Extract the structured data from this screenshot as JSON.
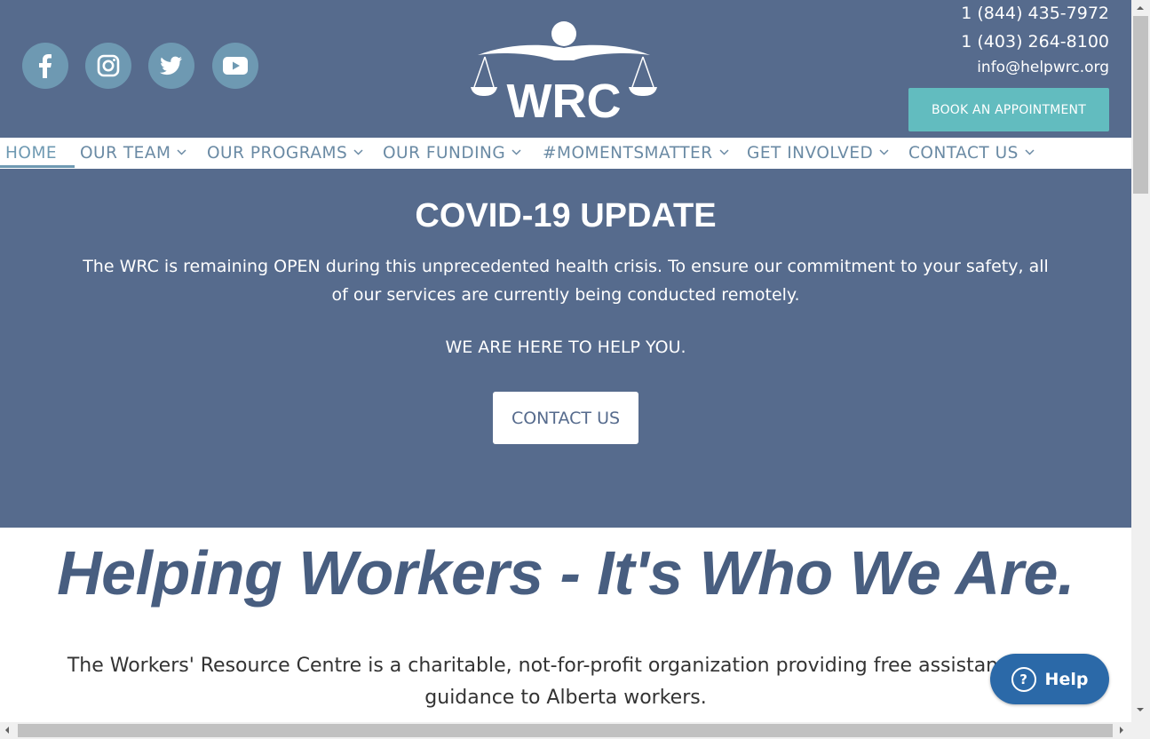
{
  "header": {
    "social": [
      {
        "name": "facebook-icon"
      },
      {
        "name": "instagram-icon"
      },
      {
        "name": "twitter-icon"
      },
      {
        "name": "youtube-icon"
      }
    ],
    "logo_text": "WRC",
    "phone1": "1 (844) 435-7972",
    "phone2": "1 (403) 264-8100",
    "email": "info@helpwrc.org",
    "book_label": "BOOK AN APPOINTMENT"
  },
  "nav": {
    "items": [
      {
        "label": "HOME",
        "active": true
      },
      {
        "label": "OUR TEAM"
      },
      {
        "label": "OUR PROGRAMS"
      },
      {
        "label": "OUR FUNDING"
      },
      {
        "label": "#MOMENTSMATTER"
      },
      {
        "label": "GET INVOLVED"
      },
      {
        "label": "CONTACT US"
      }
    ]
  },
  "hero": {
    "title": "COVID-19 UPDATE",
    "text": "The WRC is remaining OPEN during this unprecedented health crisis. To ensure our commitment to your safety, all of our services are currently being conducted remotely.",
    "sub": "WE ARE HERE TO HELP YOU.",
    "button": "CONTACT US"
  },
  "main": {
    "tagline": "Helping Workers - It's Who We Are.",
    "intro": "The Workers' Resource Centre is a charitable, not-for-profit organization providing free assistance and guidance to Alberta workers."
  },
  "help": {
    "label": "Help"
  },
  "colors": {
    "header_bg": "#566b8d",
    "social_bg": "#6e99b2",
    "book_btn": "#62bcbf",
    "nav_text": "#6a8aa4",
    "tagline": "#485e80",
    "help_btn": "#2b69a8"
  }
}
